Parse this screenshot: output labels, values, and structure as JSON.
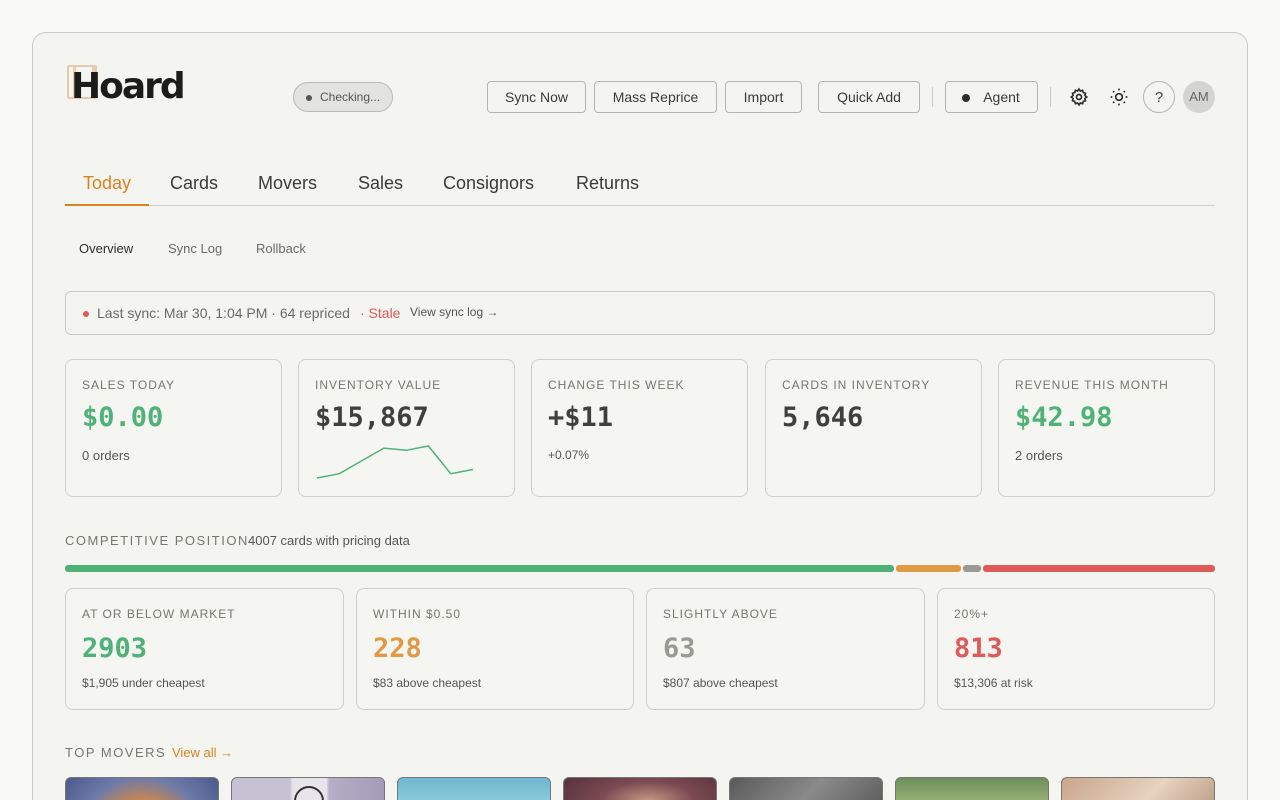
{
  "app": {
    "logo": "Hoard",
    "status": "Checking..."
  },
  "toolbar": {
    "sync_now": "Sync Now",
    "mass_reprice": "Mass Reprice",
    "import": "Import",
    "quick_add": "Quick Add",
    "agent": "Agent",
    "help": "?",
    "avatar": "AM"
  },
  "tabs": [
    "Today",
    "Cards",
    "Movers",
    "Sales",
    "Consignors",
    "Returns"
  ],
  "subtabs": [
    "Overview",
    "Sync Log",
    "Rollback"
  ],
  "sync": {
    "text": "Last sync: Mar 30, 1:04 PM · 64 repriced",
    "stale": "· Stale",
    "link": "View sync log →"
  },
  "kpis": [
    {
      "label": "SALES TODAY",
      "value": "$0.00",
      "sub": "0 orders"
    },
    {
      "label": "INVENTORY VALUE",
      "value": "$15,867",
      "sparkline": [
        1,
        2,
        5,
        8,
        7.5,
        8.5,
        2,
        3
      ]
    },
    {
      "label": "CHANGE THIS WEEK",
      "value": "+$11",
      "sub": "+0.07%"
    },
    {
      "label": "CARDS IN INVENTORY",
      "value": "5,646"
    },
    {
      "label": "REVENUE THIS MONTH",
      "value": "$42.98",
      "sub": "2 orders"
    }
  ],
  "competitive": {
    "title": "COMPETITIVE POSITION",
    "note": "4007 cards with pricing data",
    "segments": [
      {
        "label": "AT OR BELOW MARKET",
        "value": "2903",
        "sub": "$1,905 under cheapest",
        "color": "#4fb277"
      },
      {
        "label": "WITHIN $0.50",
        "value": "228",
        "sub": "$83 above cheapest",
        "color": "#e09a44"
      },
      {
        "label": "SLIGHTLY ABOVE",
        "value": "63",
        "sub": "$807 above cheapest",
        "color": "#9a9a95"
      },
      {
        "label": "20%+",
        "value": "813",
        "sub": "$13,306 at risk",
        "color": "#e05a5a"
      }
    ]
  },
  "movers": {
    "title": "TOP MOVERS",
    "view_all": "View all →"
  }
}
